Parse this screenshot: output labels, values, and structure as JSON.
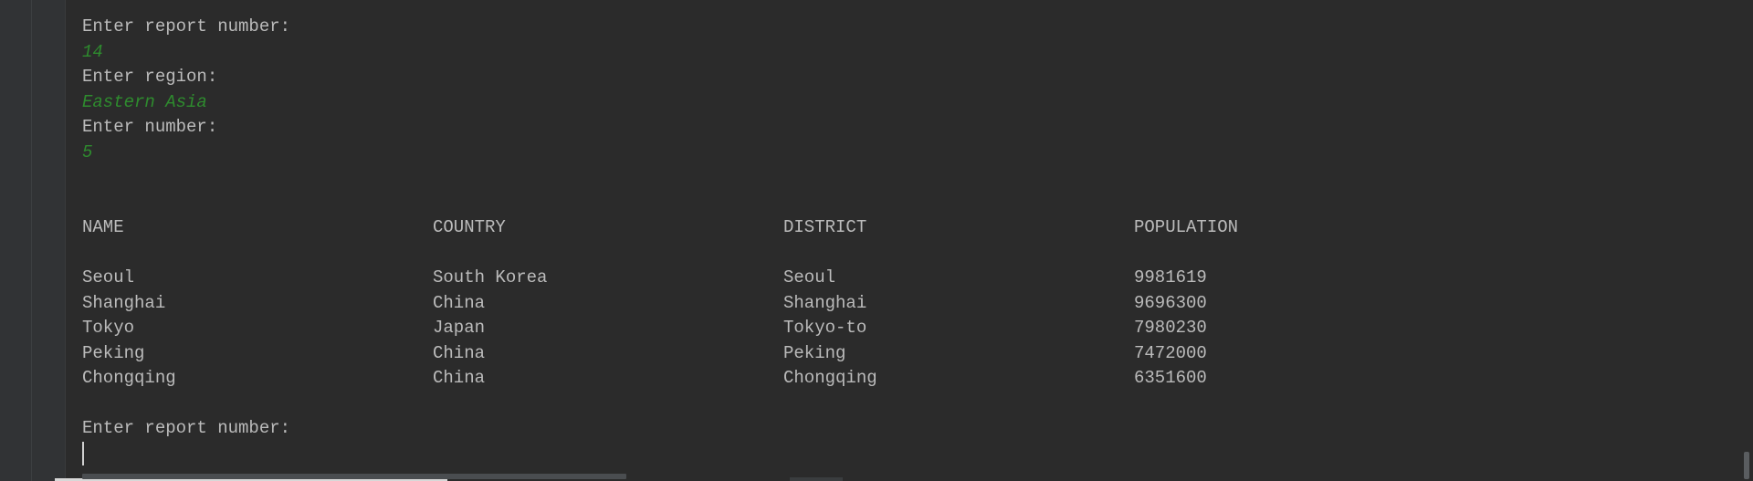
{
  "console": {
    "session1": {
      "prompt_report": "Enter report number:",
      "input_report": "14",
      "prompt_region": "Enter region:",
      "input_region": "Eastern Asia",
      "prompt_number": "Enter number:",
      "input_number": "5"
    },
    "table": {
      "headers": [
        "NAME",
        "COUNTRY",
        "DISTRICT",
        "POPULATION"
      ],
      "rows": [
        [
          "Seoul",
          "South Korea",
          "Seoul",
          "9981619"
        ],
        [
          "Shanghai",
          "China",
          "Shanghai",
          "9696300"
        ],
        [
          "Tokyo",
          "Japan",
          "Tokyo-to",
          "7980230"
        ],
        [
          "Peking",
          "China",
          "Peking",
          "7472000"
        ],
        [
          "Chongqing",
          "China",
          "Chongqing",
          "6351600"
        ]
      ]
    },
    "session2": {
      "prompt_report": "Enter report number:"
    }
  }
}
